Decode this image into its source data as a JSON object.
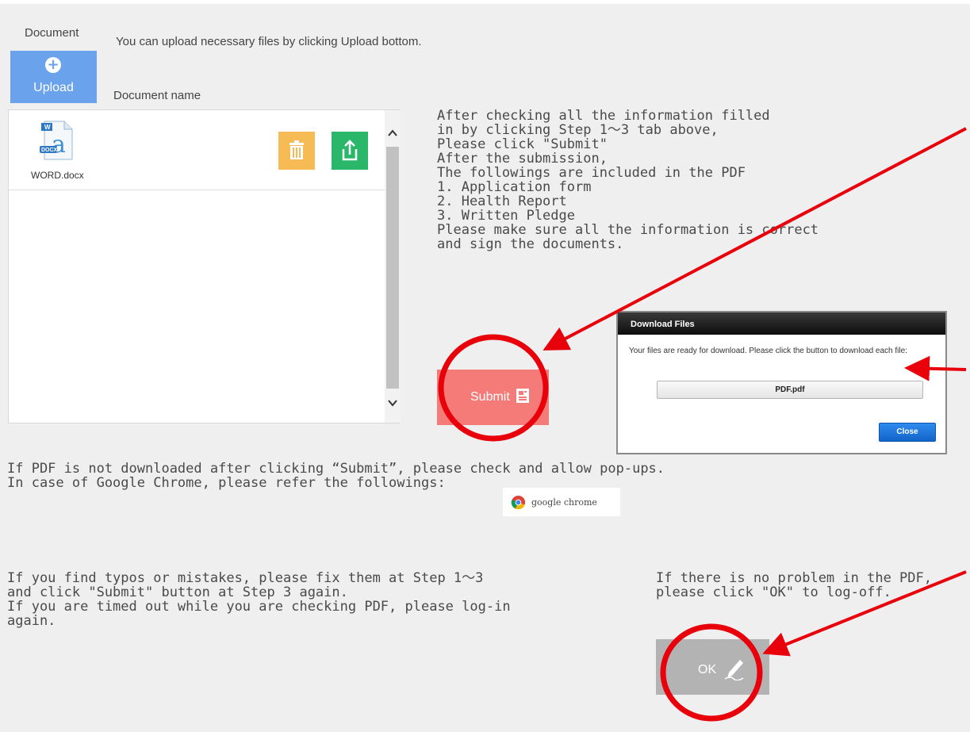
{
  "header": {
    "section_label": "Document",
    "hint": "You can upload necessary files by clicking Upload bottom.",
    "upload_label": "Upload",
    "column_label": "Document name"
  },
  "documents": [
    {
      "name": "WORD.docx",
      "type_badge": "DOCX",
      "icon": "word-file-icon"
    }
  ],
  "instructions": {
    "check_text": "After checking all the information filled\nin by clicking Step 1～3 tab above,\nPlease click \"Submit\"",
    "submission_text": "After the submission,\nThe followings are included in the PDF\n1. Application form\n2. Health Report\n3. Written Pledge\nPlease make sure all the information is correct\nand sign the documents."
  },
  "submit": {
    "label": "Submit"
  },
  "download_dialog": {
    "title": "Download Files",
    "message": "Your files are ready for download. Please click the button to download each file:",
    "file_button": "PDF.pdf",
    "close_label": "Close"
  },
  "popup_note": {
    "text": "If PDF is not downloaded after clicking “Submit”, please check and allow pop-ups.\nIn case of Google Chrome, please refer the followings:",
    "chrome_label": "google chrome"
  },
  "fix_note": "If you find typos or mistakes, please fix them at Step 1～3\nand click \"Submit\" button at Step 3 again.\nIf you are timed out while you are checking PDF, please log-in\nagain.",
  "ok_note": "If there is no problem in the PDF,\nplease click \"OK\" to log-off.",
  "ok": {
    "label": "OK"
  },
  "colors": {
    "upload": "#6aa2ec",
    "submit": "#f57b78",
    "delete": "#f6bb55",
    "share": "#2bb769",
    "ok": "#b3b3b3",
    "annotation": "#e8000b"
  }
}
